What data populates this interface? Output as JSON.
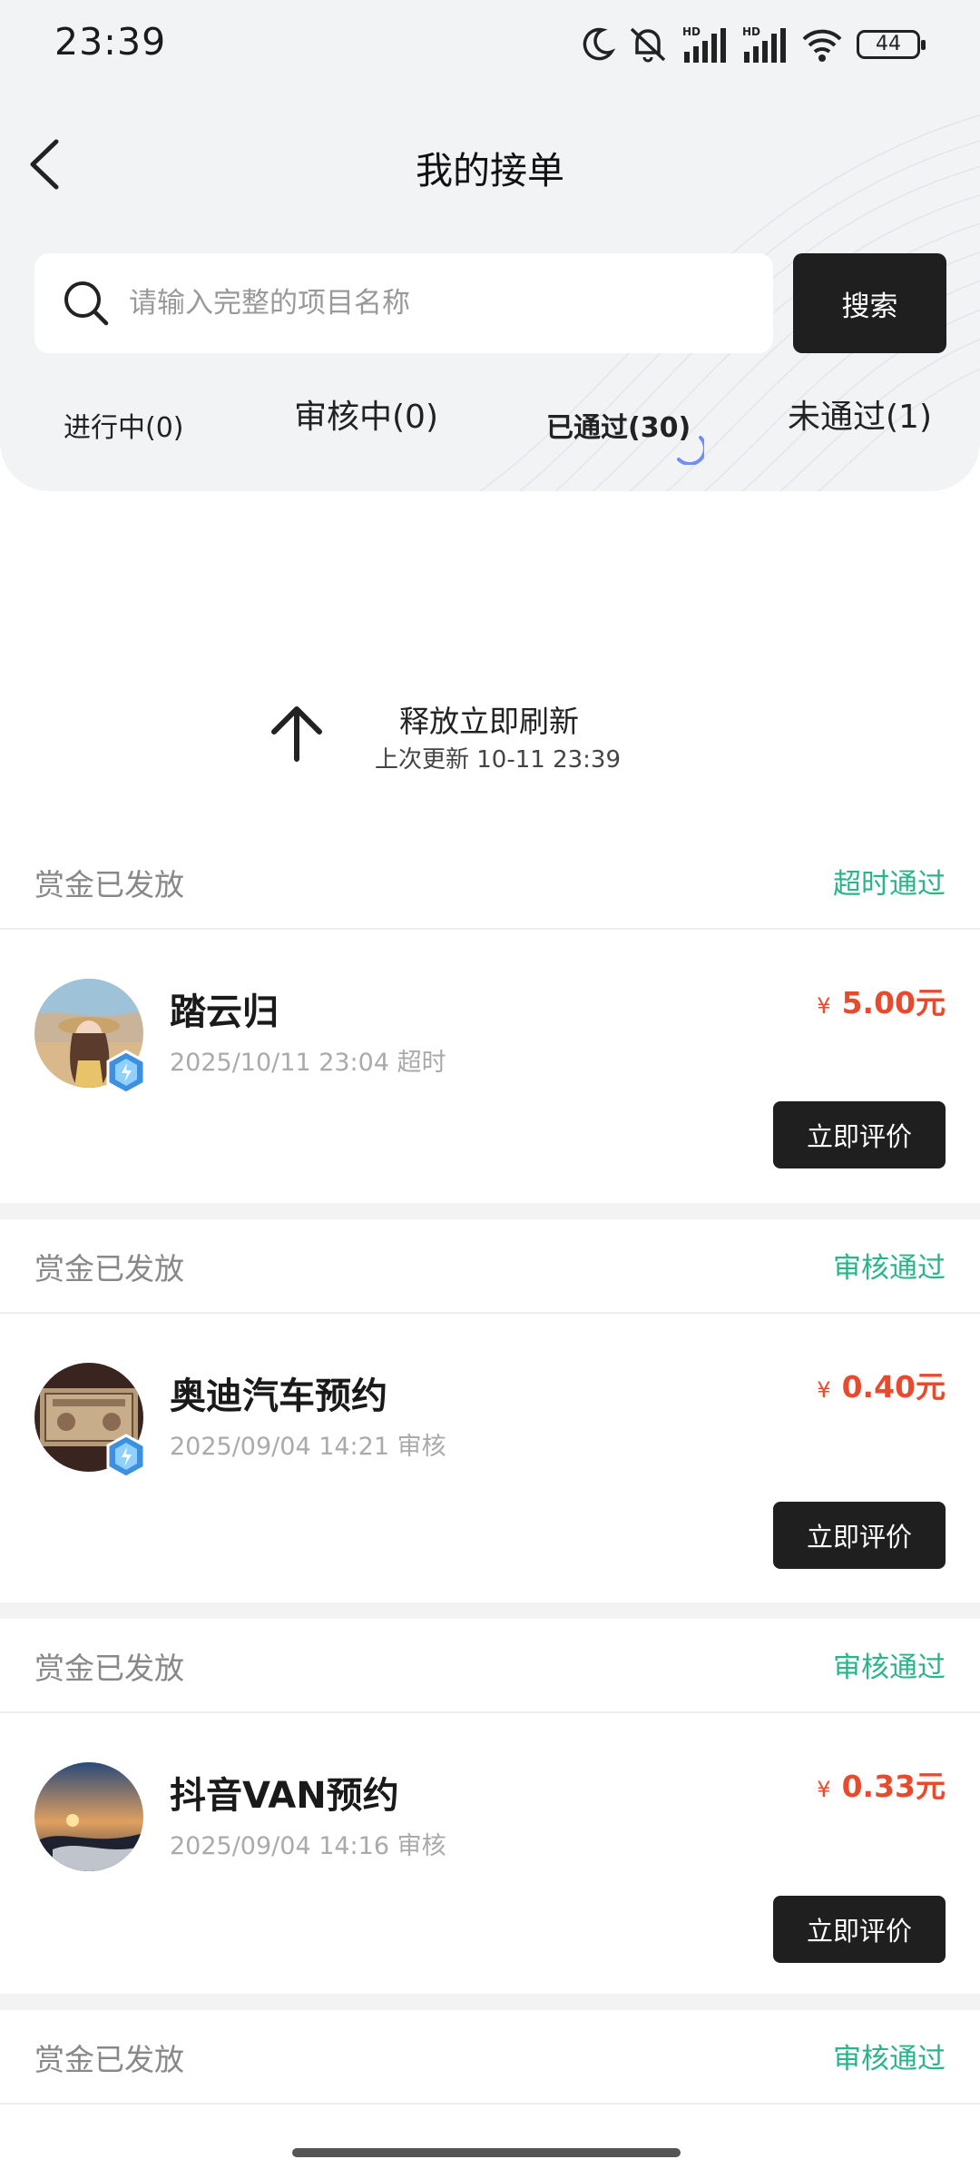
{
  "status_bar": {
    "time": "23:39",
    "battery": "44",
    "signal_label": "HD"
  },
  "header": {
    "title": "我的接单"
  },
  "search": {
    "placeholder": "请输入完整的项目名称",
    "button": "搜索"
  },
  "tabs": [
    {
      "label": "进行中(0)"
    },
    {
      "label": "审核中(0)"
    },
    {
      "label": "已通过(30)",
      "active": true
    },
    {
      "label": "未通过(1)"
    }
  ],
  "refresh": {
    "title": "释放立即刷新",
    "subtitle": "上次更新 10-11 23:39"
  },
  "cards": [
    {
      "section_label": "赏金已发放",
      "status": "超时通过",
      "name": "踏云归",
      "meta": "2025/10/11 23:04 超时",
      "currency": "¥",
      "price": "5.00元",
      "action": "立即评价",
      "verified": true
    },
    {
      "section_label": "赏金已发放",
      "status": "审核通过",
      "name": "奥迪汽车预约",
      "meta": "2025/09/04 14:21 审核",
      "currency": "¥",
      "price": "0.40元",
      "action": "立即评价",
      "verified": true
    },
    {
      "section_label": "赏金已发放",
      "status": "审核通过",
      "name": "抖音VAN预约",
      "meta": "2025/09/04 14:16 审核",
      "currency": "¥",
      "price": "0.33元",
      "action": "立即评价",
      "verified": false
    },
    {
      "section_label": "赏金已发放",
      "status": "审核通过"
    }
  ],
  "colors": {
    "accent_green": "#2bb38a",
    "price_red": "#e84a2d",
    "button_dark": "#1f1f1f"
  }
}
